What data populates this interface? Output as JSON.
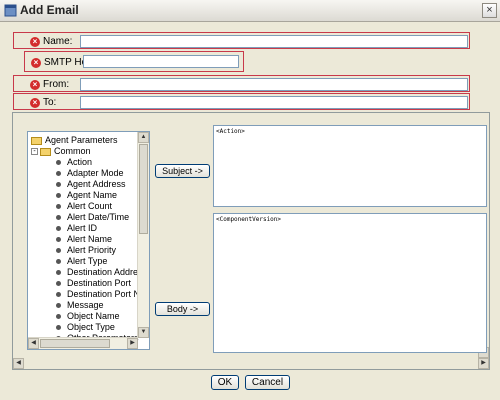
{
  "window": {
    "title": "Add Email",
    "close_glyph": "×"
  },
  "fields": {
    "name": {
      "label": "Name:",
      "value": ""
    },
    "smtp_host": {
      "label": "SMTP Host:",
      "value": ""
    },
    "from": {
      "label": "From:",
      "value": ""
    },
    "to": {
      "label": "To:",
      "value": ""
    },
    "error_glyph": "×"
  },
  "tree": {
    "root": "Agent Parameters",
    "group": "Common",
    "expander_glyph": "-",
    "items": [
      "Action",
      "Adapter Mode",
      "Agent Address",
      "Agent Name",
      "Alert Count",
      "Alert Date/Time",
      "Alert ID",
      "Alert Name",
      "Alert Priority",
      "Alert Type",
      "Destination Address",
      "Destination Port",
      "Destination Port Nam",
      "Message",
      "Object Name",
      "Object Type",
      "Other Parameters"
    ]
  },
  "buttons": {
    "subject": "Subject ->",
    "body": "Body ->",
    "ok": "OK",
    "cancel": "Cancel"
  },
  "subject_text": "<Action>",
  "body_text": "<ComponentVersion>",
  "scroll_glyphs": {
    "up": "▲",
    "down": "▼",
    "left": "◀",
    "right": "▶"
  },
  "icons": {
    "app": "window-icon",
    "error": "error-icon",
    "folder": "folder-icon"
  }
}
